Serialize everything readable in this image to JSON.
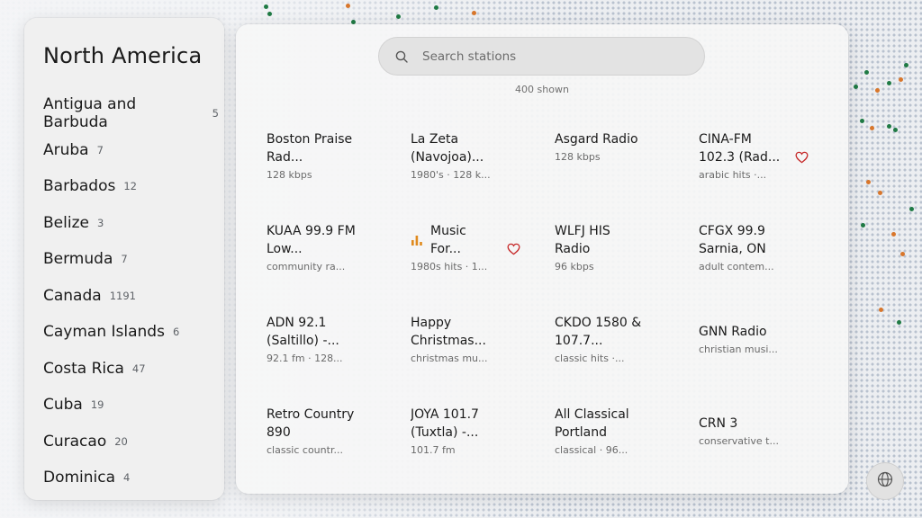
{
  "sidebar": {
    "title": "North America",
    "countries": [
      {
        "name": "Antigua and Barbuda",
        "count": "5"
      },
      {
        "name": "Aruba",
        "count": "7"
      },
      {
        "name": "Barbados",
        "count": "12"
      },
      {
        "name": "Belize",
        "count": "3"
      },
      {
        "name": "Bermuda",
        "count": "7"
      },
      {
        "name": "Canada",
        "count": "1191"
      },
      {
        "name": "Cayman Islands",
        "count": "6"
      },
      {
        "name": "Costa Rica",
        "count": "47"
      },
      {
        "name": "Cuba",
        "count": "19"
      },
      {
        "name": "Curacao",
        "count": "20"
      },
      {
        "name": "Dominica",
        "count": "4"
      }
    ]
  },
  "search": {
    "placeholder": "Search stations",
    "value": ""
  },
  "shown_label": "400 shown",
  "stations": [
    {
      "title": "Boston Praise Rad...",
      "meta": "128 kbps",
      "favorite": false,
      "playing": false
    },
    {
      "title": "La Zeta (Navojoa)...",
      "meta": "1980's  ·  128 k...",
      "favorite": false,
      "playing": false
    },
    {
      "title": "Asgard Radio",
      "meta": "128 kbps",
      "favorite": false,
      "playing": false
    },
    {
      "title": "CINA-FM 102.3 (Rad...",
      "meta": "arabic hits  ·...",
      "favorite": true,
      "playing": false
    },
    {
      "title": "KUAA 99.9 FM Low...",
      "meta": "community ra...",
      "favorite": false,
      "playing": false
    },
    {
      "title": "Music For...",
      "meta": "1980s hits  ·  1...",
      "favorite": true,
      "playing": true
    },
    {
      "title": "WLFJ HIS Radio",
      "meta": "96 kbps",
      "favorite": false,
      "playing": false
    },
    {
      "title": "CFGX 99.9 Sarnia, ON",
      "meta": "adult contem...",
      "favorite": false,
      "playing": false
    },
    {
      "title": "ADN 92.1 (Saltillo) -...",
      "meta": "92.1 fm  ·  128...",
      "favorite": false,
      "playing": false
    },
    {
      "title": "Happy Christmas...",
      "meta": "christmas mu...",
      "favorite": false,
      "playing": false
    },
    {
      "title": "CKDO 1580 & 107.7...",
      "meta": "classic hits  ·...",
      "favorite": false,
      "playing": false
    },
    {
      "title": "GNN Radio",
      "meta": "christian musi...",
      "favorite": false,
      "playing": false
    },
    {
      "title": "Retro Country 890",
      "meta": "classic countr...",
      "favorite": false,
      "playing": false
    },
    {
      "title": "JOYA 101.7 (Tuxtla) -...",
      "meta": "101.7 fm",
      "favorite": false,
      "playing": false
    },
    {
      "title": "All Classical Portland",
      "meta": "classical  ·  96...",
      "favorite": false,
      "playing": false
    },
    {
      "title": "CRN 3",
      "meta": "conservative t...",
      "favorite": false,
      "playing": false
    }
  ],
  "icons": {
    "search": "search-icon",
    "heart": "heart-icon",
    "now_playing": "equalizer-bars-icon",
    "globe": "globe-icon"
  },
  "colors": {
    "accent_playing": "#e08a1e",
    "favorite_heart": "#c62828",
    "map_marker_green": "#1f7a44",
    "map_marker_orange": "#d8762b"
  }
}
